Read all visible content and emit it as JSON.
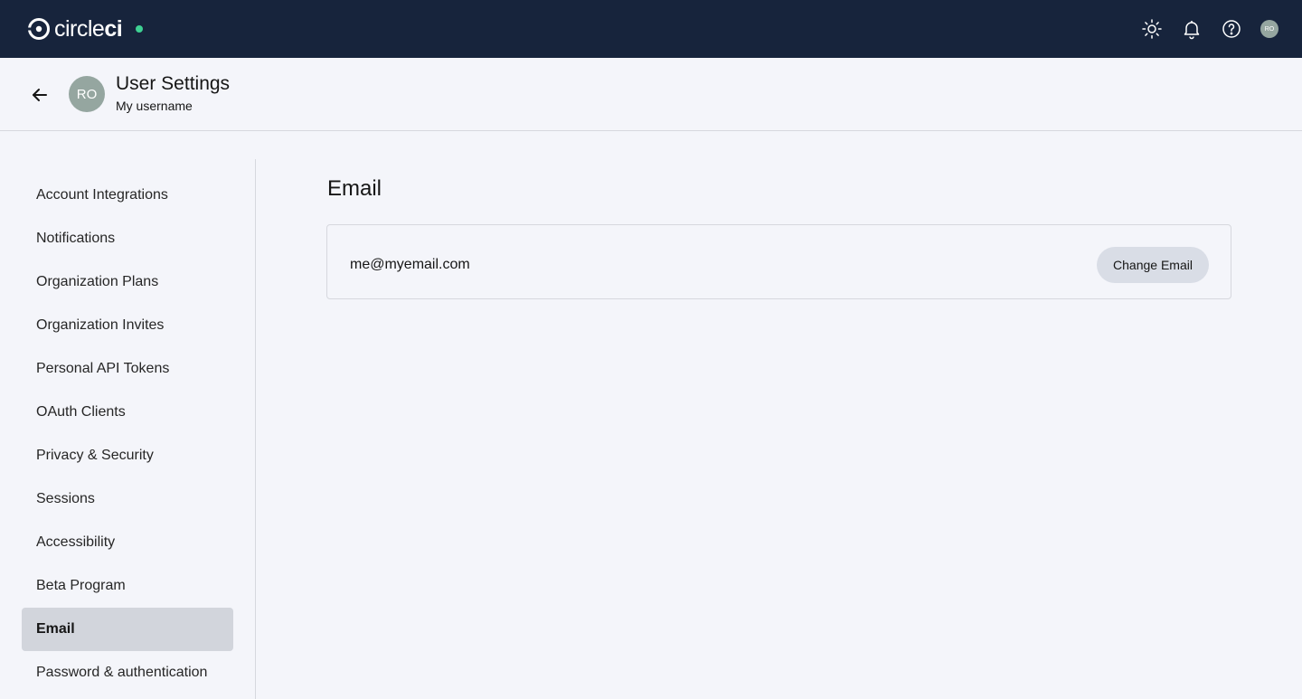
{
  "brand": {
    "name_light": "circle",
    "name_bold": "ci",
    "status_color": "#3ed193"
  },
  "topbar": {
    "icons": [
      "sun-icon",
      "bell-icon",
      "help-icon"
    ],
    "avatar_initials": "RO"
  },
  "header": {
    "avatar_initials": "RO",
    "title": "User Settings",
    "subtitle": "My username"
  },
  "sidebar": {
    "items": [
      {
        "label": "Account Integrations",
        "active": false
      },
      {
        "label": "Notifications",
        "active": false
      },
      {
        "label": "Organization Plans",
        "active": false
      },
      {
        "label": "Organization Invites",
        "active": false
      },
      {
        "label": "Personal API Tokens",
        "active": false
      },
      {
        "label": "OAuth Clients",
        "active": false
      },
      {
        "label": "Privacy & Security",
        "active": false
      },
      {
        "label": "Sessions",
        "active": false
      },
      {
        "label": "Accessibility",
        "active": false
      },
      {
        "label": "Beta Program",
        "active": false
      },
      {
        "label": "Email",
        "active": true
      },
      {
        "label": "Password & authentication",
        "active": false
      }
    ]
  },
  "main": {
    "title": "Email",
    "email": "me@myemail.com",
    "change_button": "Change Email"
  },
  "colors": {
    "topbar_bg": "#17243c",
    "page_bg": "#f4f5fa",
    "active_item_bg": "#d2d5dc",
    "button_bg": "#d9dde6",
    "avatar_bg": "#95a6a0"
  }
}
